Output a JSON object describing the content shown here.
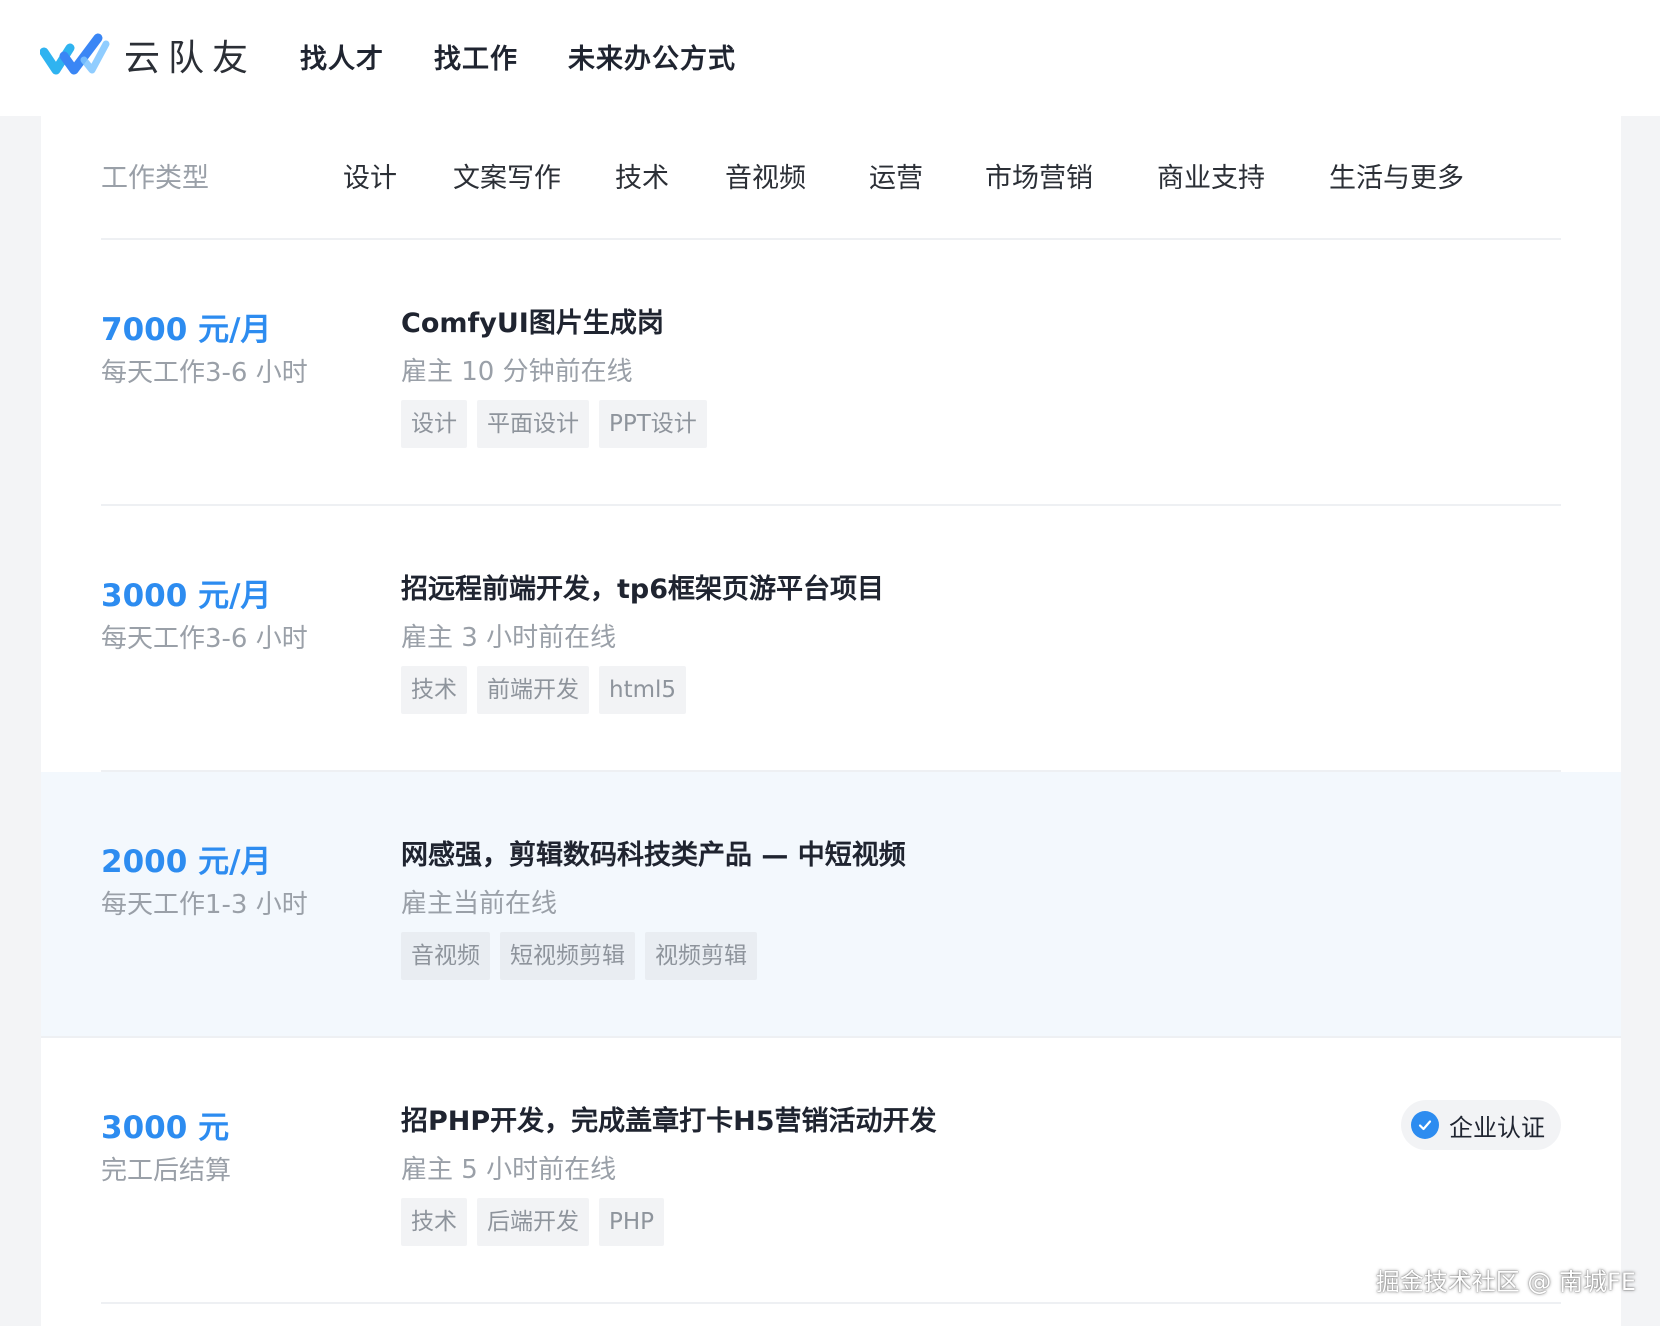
{
  "header": {
    "logo_text": "云队友",
    "nav": [
      "找人才",
      "找工作",
      "未来办公方式"
    ]
  },
  "filter": {
    "label": "工作类型",
    "categories": [
      "设计",
      "文案写作",
      "技术",
      "音视频",
      "运营",
      "市场营销",
      "商业支持",
      "生活与更多"
    ]
  },
  "jobs": [
    {
      "pay": "7000 元/月",
      "hours": "每天工作3-6 小时",
      "title": "ComfyUI图片生成岗",
      "online": "雇主 10 分钟前在线",
      "tags": [
        "设计",
        "平面设计",
        "PPT设计"
      ]
    },
    {
      "pay": "3000 元/月",
      "hours": "每天工作3-6 小时",
      "title": "招远程前端开发，tp6框架页游平台项目",
      "online": "雇主 3 小时前在线",
      "tags": [
        "技术",
        "前端开发",
        "html5"
      ]
    },
    {
      "pay": "2000 元/月",
      "hours": "每天工作1-3 小时",
      "title": "网感强，剪辑数码科技类产品 — 中短视频",
      "online": "雇主当前在线",
      "tags": [
        "音视频",
        "短视频剪辑",
        "视频剪辑"
      ]
    },
    {
      "pay": "3000 元",
      "hours": "完工后结算",
      "title": "招PHP开发，完成盖章打卡H5营销活动开发",
      "online": "雇主 5 小时前在线",
      "tags": [
        "技术",
        "后端开发",
        "PHP"
      ],
      "badge": "企业认证"
    }
  ],
  "watermark": "掘金技术社区 @ 南城FE",
  "colors": {
    "accent": "#2d8cf0",
    "highlight_row": "#f3f8fd",
    "tag_bg": "#f2f3f5",
    "muted_text": "#9aa0a8"
  }
}
